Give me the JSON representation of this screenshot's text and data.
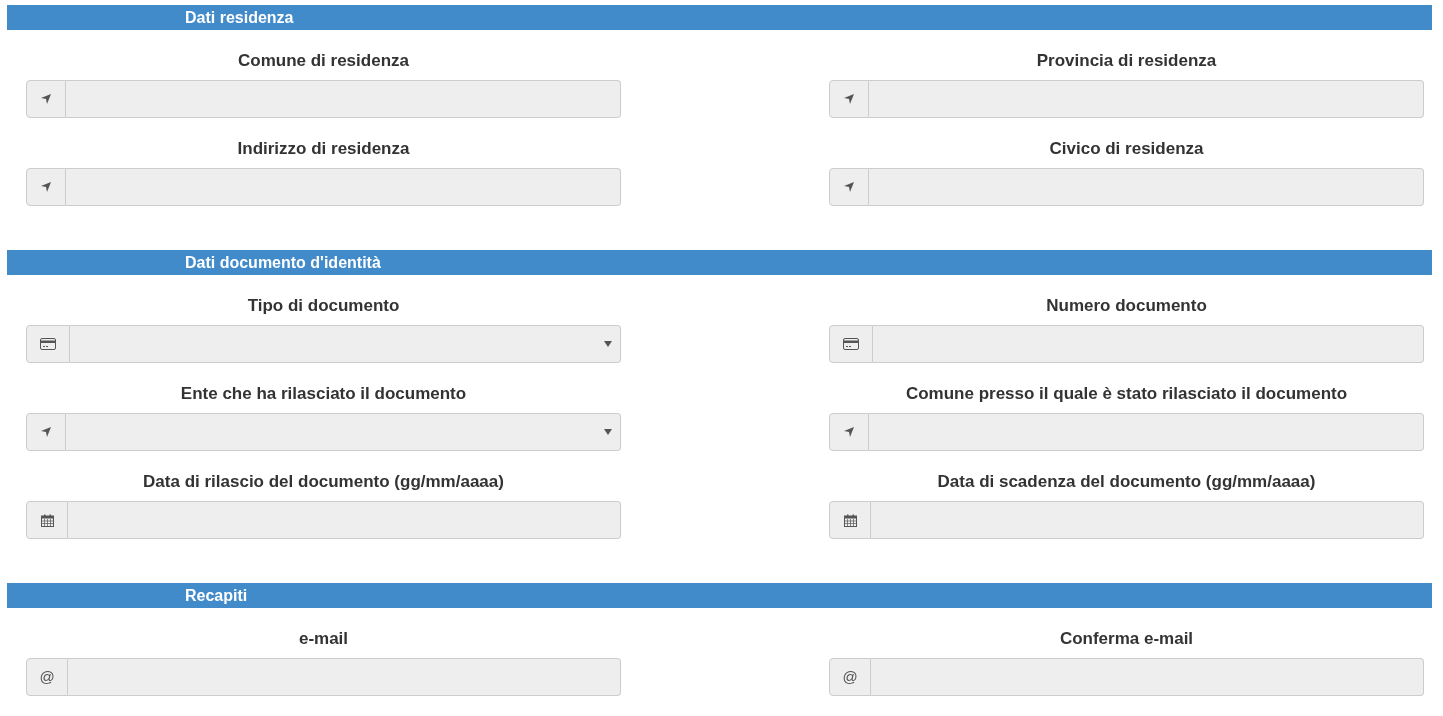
{
  "sections": [
    {
      "title": "Dati residenza",
      "fields": [
        {
          "label": "Comune di residenza",
          "kind": "place"
        },
        {
          "label": "Provincia di residenza",
          "kind": "place"
        },
        {
          "label": "Indirizzo di residenza",
          "kind": "place"
        },
        {
          "label": "Civico di residenza",
          "kind": "place"
        }
      ]
    },
    {
      "title": "Dati documento d'identità",
      "fields": [
        {
          "label": "Tipo di documento",
          "kind": "cardchoice"
        },
        {
          "label": "Numero documento",
          "kind": "card"
        },
        {
          "label": "Ente che ha rilasciato il documento",
          "kind": "placechoice"
        },
        {
          "label": "Comune presso il quale è stato rilasciato il documento",
          "kind": "place"
        },
        {
          "label": "Data di rilascio del documento (gg/mm/aaaa)",
          "kind": "date"
        },
        {
          "label": "Data di scadenza del documento (gg/mm/aaaa)",
          "kind": "date"
        }
      ]
    },
    {
      "title": "Recapiti",
      "fields": [
        {
          "label": "e-mail",
          "kind": "email",
          "addon_text": "@"
        },
        {
          "label": "Conferma e-mail",
          "kind": "email",
          "addon_text": "@"
        }
      ]
    }
  ]
}
